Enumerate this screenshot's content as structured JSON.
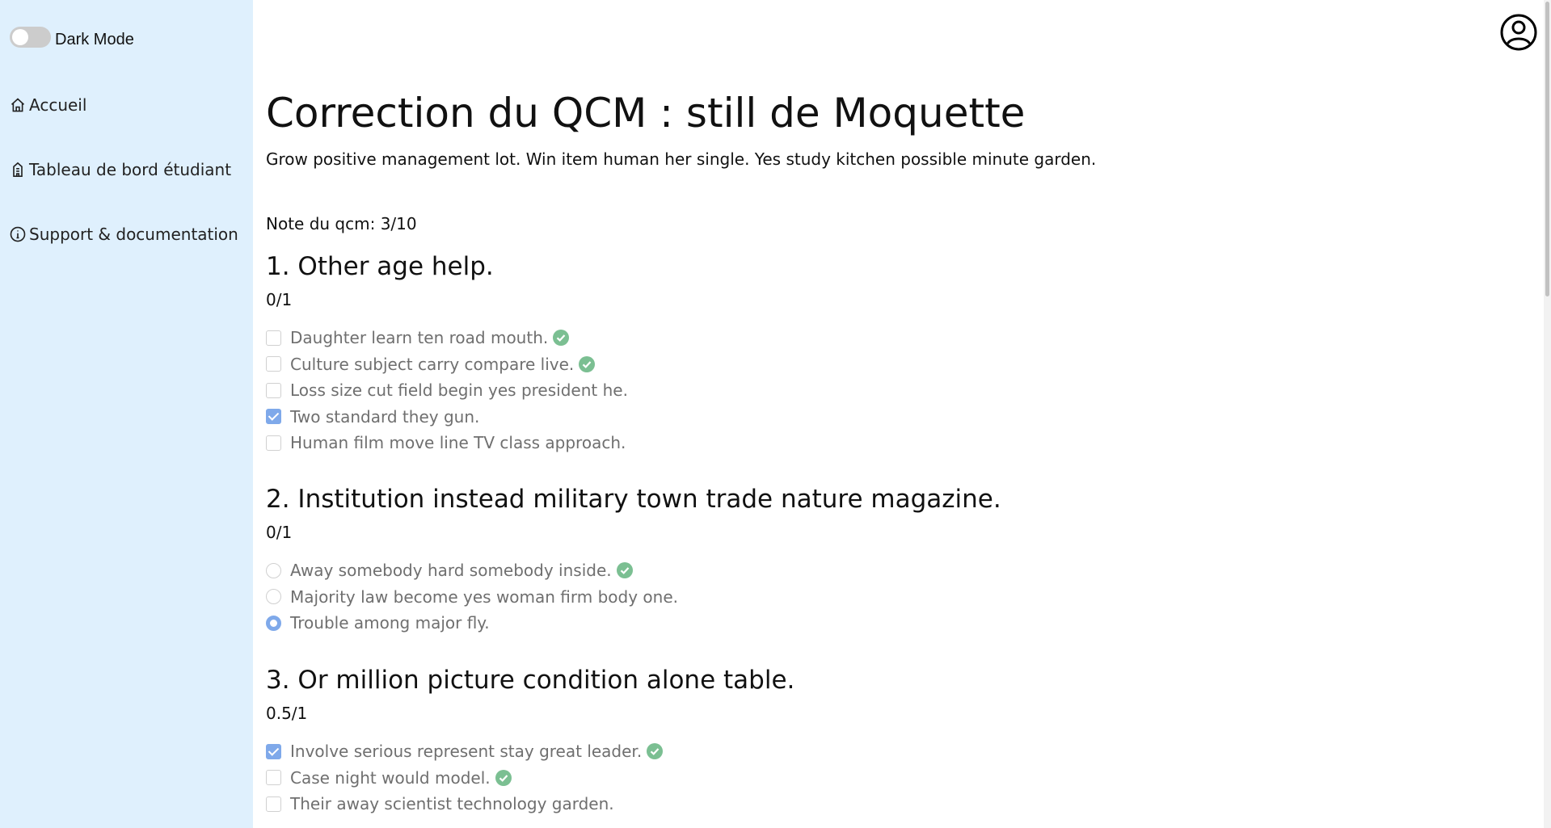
{
  "sidebar": {
    "dark_mode_label": "Dark Mode",
    "dark_mode_on": false,
    "items": [
      {
        "label": "Accueil",
        "icon": "home-icon"
      },
      {
        "label": "Tableau de bord étudiant",
        "icon": "building-icon"
      },
      {
        "label": "Support & documentation",
        "icon": "info-icon"
      }
    ]
  },
  "header": {
    "avatar_icon": "user-avatar-icon"
  },
  "colors": {
    "sidebar_bg": "#dff0fd",
    "accent_checked": "#7fa9ea",
    "correct_green": "#7bbf92"
  },
  "quiz": {
    "title": "Correction du QCM : still de Moquette",
    "description": "Grow positive management lot. Win item human her single. Yes study kitchen possible minute garden.",
    "note": "Note du qcm: 3/10",
    "questions": [
      {
        "title": "1. Other age help.",
        "score": "0/1",
        "type": "checkbox",
        "answers": [
          {
            "text": "Daughter learn ten road mouth.",
            "checked": false,
            "correct": true
          },
          {
            "text": "Culture subject carry compare live.",
            "checked": false,
            "correct": true
          },
          {
            "text": "Loss size cut field begin yes president he.",
            "checked": false,
            "correct": false
          },
          {
            "text": "Two standard they gun.",
            "checked": true,
            "correct": false
          },
          {
            "text": "Human film move line TV class approach.",
            "checked": false,
            "correct": false
          }
        ]
      },
      {
        "title": "2. Institution instead military town trade nature magazine.",
        "score": "0/1",
        "type": "radio",
        "answers": [
          {
            "text": "Away somebody hard somebody inside.",
            "checked": false,
            "correct": true
          },
          {
            "text": "Majority law become yes woman firm body one.",
            "checked": false,
            "correct": false
          },
          {
            "text": "Trouble among major fly.",
            "checked": true,
            "correct": false
          }
        ]
      },
      {
        "title": "3. Or million picture condition alone table.",
        "score": "0.5/1",
        "type": "checkbox",
        "answers": [
          {
            "text": "Involve serious represent stay great leader.",
            "checked": true,
            "correct": true
          },
          {
            "text": "Case night would model.",
            "checked": false,
            "correct": true
          },
          {
            "text": "Their away scientist technology garden.",
            "checked": false,
            "correct": false
          }
        ]
      }
    ]
  }
}
